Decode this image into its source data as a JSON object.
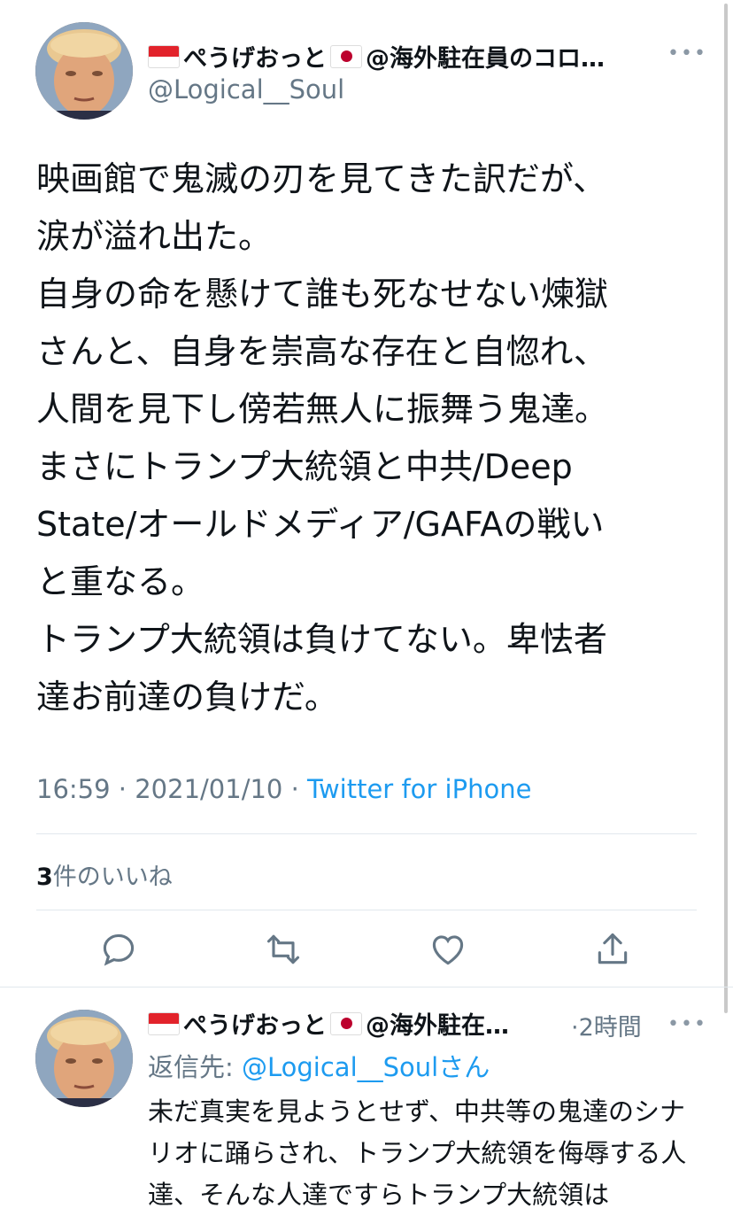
{
  "tweet": {
    "display_name": "ぺうげおっと",
    "display_name_suffix": "@海外駐在員のコロ…",
    "handle": "@Logical__Soul",
    "text": "映画館で鬼滅の刃を見てきた訳だが、\n涙が溢れ出た。\n自身の命を懸けて誰も死なせない煉獄\nさんと、自身を崇高な存在と自惚れ、\n人間を見下し傍若無人に振舞う鬼達。\nまさにトランプ大統領と中共/Deep\nState/オールドメディア/GAFAの戦い\nと重なる。\nトランプ大統領は負けてない。卑怯者\n達お前達の負けだ。",
    "time": "16:59 · 2021/01/10 · ",
    "source": "Twitter for iPhone",
    "likes_count": "3",
    "likes_label": "件のいいね"
  },
  "reply": {
    "display_name": "ぺうげおっと",
    "display_name_suffix": "@海外駐在…",
    "time": "·2時間",
    "reply_to_label": "返信先: ",
    "reply_to_handle": "@Logical__Soul",
    "reply_to_suffix": "さん",
    "text": "未だ真実を見ようとせず、中共等の鬼達のシナリオに踊らされ、トランプ大統領を侮辱する人達、そんな人達ですらトランプ大統領は"
  },
  "icons": {
    "more": "more-horizontal-icon",
    "reply": "reply-icon",
    "retweet": "retweet-icon",
    "like": "heart-icon",
    "share": "share-icon"
  },
  "colors": {
    "link": "#1d9bf0",
    "secondary_text": "#657786",
    "icon": "#657786"
  }
}
